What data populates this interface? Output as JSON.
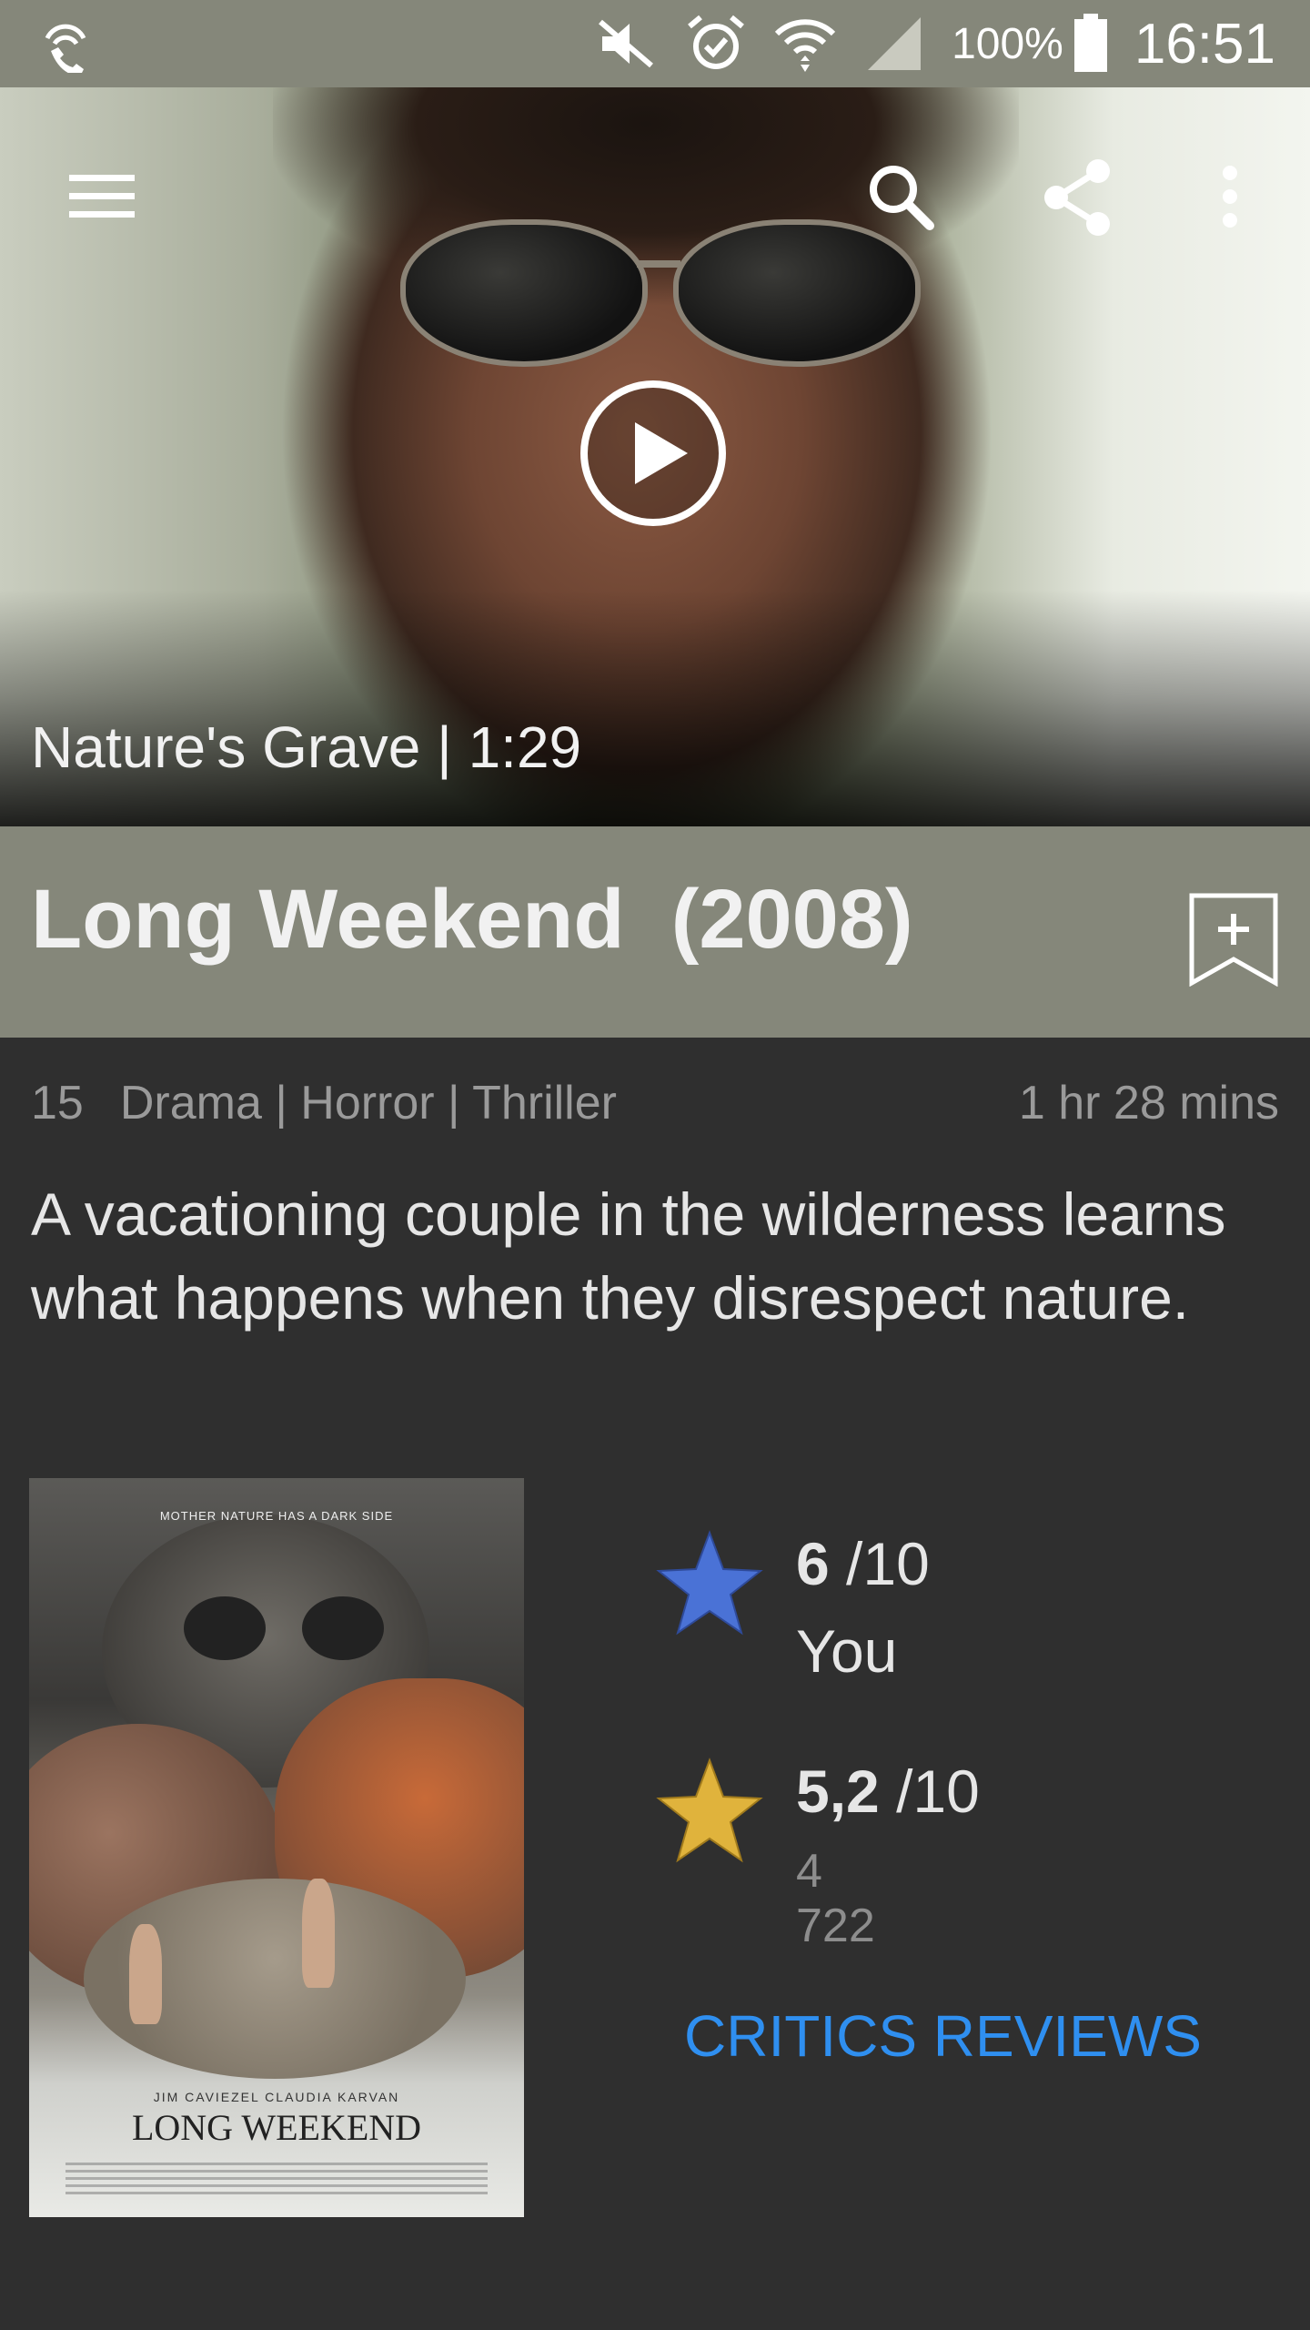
{
  "status_bar": {
    "battery": "100%",
    "time": "16:51",
    "icons": [
      "wifi-calling-icon",
      "mute-icon",
      "alarm-icon",
      "wifi-icon",
      "signal-icon",
      "battery-icon"
    ]
  },
  "toolbar": {
    "icons": [
      "menu-icon",
      "search-icon",
      "share-icon",
      "more-icon"
    ]
  },
  "video": {
    "caption": "Nature's Grave | 1:29"
  },
  "movie": {
    "title": "Long Weekend  (2008)",
    "certificate": "15",
    "genres": "Drama | Horror | Thriller",
    "runtime": "1 hr 28 mins",
    "synopsis": "A vacationing couple in the wilderness learns what happens when they disrespect nature."
  },
  "poster": {
    "tagline": "MOTHER NATURE HAS A DARK SIDE",
    "names": "JIM CAVIEZEL   CLAUDIA KARVAN",
    "title": "LONG WEEKEND"
  },
  "ratings": {
    "user": {
      "score": "6",
      "scale": " /10",
      "label": "You",
      "star_color": "#4a72d6"
    },
    "imdb": {
      "score": "5,2",
      "scale": " /10",
      "votes": "4 722",
      "star_color": "#e0b33c"
    }
  },
  "critics_label": "CRITICS REVIEWS",
  "colors": {
    "status_bar": "#85877a",
    "title_band": "#85877a",
    "background": "#2f2f2f",
    "link": "#2f8ff0"
  }
}
